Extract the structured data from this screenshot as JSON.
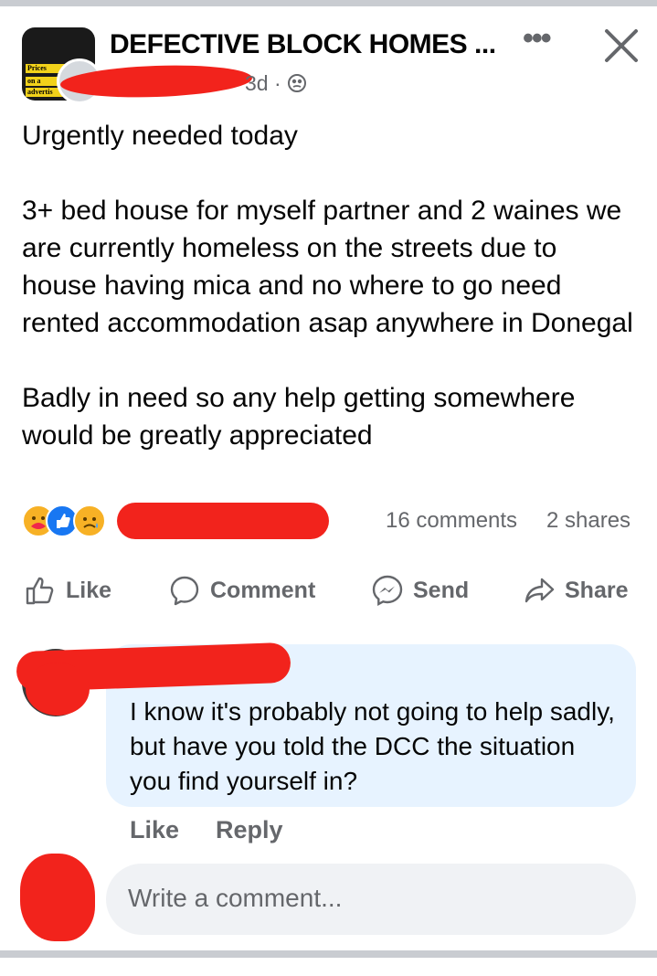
{
  "post": {
    "group_name": "DEFECTIVE BLOCK HOMES ...",
    "time": "3d ·",
    "avatar_text": [
      "Prices",
      "on a",
      "advertis"
    ],
    "paragraphs": [
      "Urgently needed today",
      "3+ bed house for myself partner and 2 waines we are currently homeless on the streets due to house having mica and no where to go need rented accommodation asap anywhere in Donegal",
      "Badly in need so any help getting somewhere would be greatly appreciated"
    ],
    "comments_count": "16 comments",
    "shares_count": "2 shares"
  },
  "actions": {
    "like": "Like",
    "comment": "Comment",
    "send": "Send",
    "share": "Share"
  },
  "comment": {
    "text": "I know it's probably not going to help sadly, but have you told the DCC the situation you find yourself in?",
    "like": "Like",
    "reply": "Reply"
  },
  "composer": {
    "placeholder": "Write a comment..."
  },
  "colors": {
    "redaction": "#f2231c",
    "bubble": "#e7f3ff",
    "muted": "#65676b",
    "like_blue": "#1877f2"
  },
  "icons": [
    "more-icon",
    "close-icon",
    "globe-icon",
    "like-icon",
    "comment-icon",
    "messenger-icon",
    "share-icon"
  ]
}
